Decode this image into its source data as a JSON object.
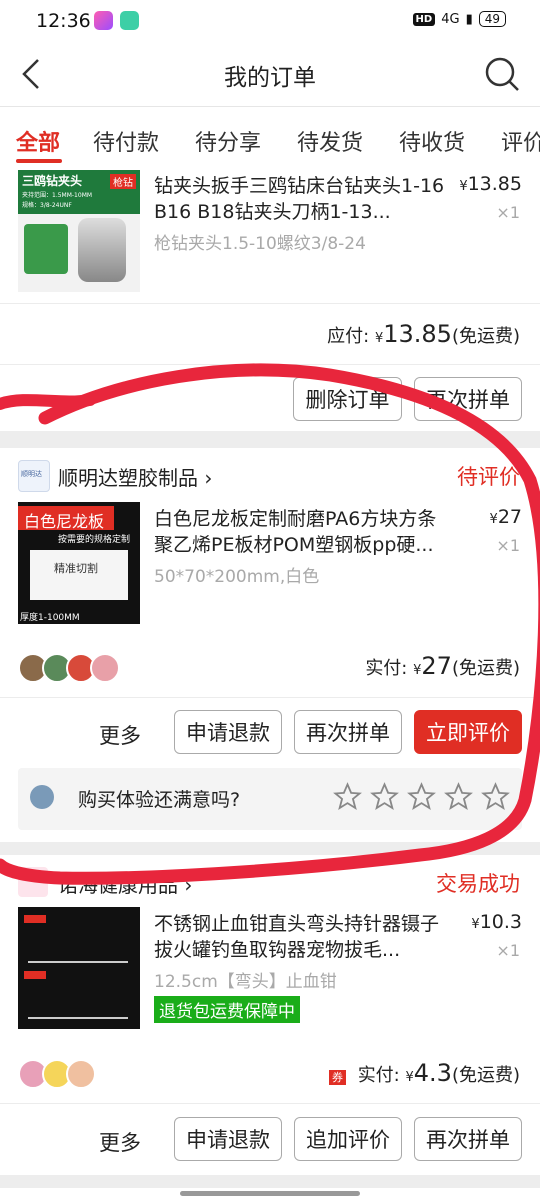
{
  "status_bar": {
    "time": "12:36",
    "network": "4G",
    "battery": "49"
  },
  "nav": {
    "title": "我的订单"
  },
  "tabs": [
    "全部",
    "待付款",
    "待分享",
    "待发货",
    "待收货",
    "评价"
  ],
  "order1": {
    "image_label_title": "三鸥钻夹头",
    "image_label_tag": "枪钻",
    "image_spec_1": "夹持范围：1.5MM-10MM",
    "image_spec_2": "规格：3/8-24UNF",
    "name": "钻夹头扳手三鸥钻床台钻夹头1-16 B16 B18钻夹头刀柄1-13...",
    "spec": "枪钻夹头1.5-10螺纹3/8-24",
    "currency": "¥",
    "price": "13.85",
    "qty": "×1",
    "pay_label": "应付:",
    "pay_currency": "¥",
    "pay_amount": "13.85",
    "shipping": "(免运费)",
    "btn_delete": "删除订单",
    "btn_rebuy": "再次拼单"
  },
  "order2": {
    "shop": "顺明达塑胶制品",
    "shop_logo_text": "顺明达",
    "status": "待评价",
    "image_label_title": "白色尼龙板",
    "image_label_sub": "按需要的规格定制",
    "image_label_cut": "精准切割",
    "image_label_thick": "厚度1-100MM",
    "name": "白色尼龙板定制耐磨PA6方块方条聚乙烯PE板材POM塑钢板pp硬...",
    "spec": "50*70*200mm,白色",
    "currency": "¥",
    "price": "27",
    "qty": "×1",
    "pay_label": "实付:",
    "pay_currency": "¥",
    "pay_amount": "27",
    "shipping": "(免运费)",
    "more": "更多",
    "btn_refund": "申请退款",
    "btn_rebuy": "再次拼单",
    "btn_review": "立即评价",
    "rate_question": "购买体验还满意吗?"
  },
  "order3": {
    "shop": "诺海健康用品",
    "status": "交易成功",
    "name": "不锈钢止血钳直头弯头持针器镊子拔火罐钓鱼取钩器宠物拔毛...",
    "spec": "12.5cm【弯头】止血钳",
    "guarantee": "退货包运费保障中",
    "currency": "¥",
    "price": "10.3",
    "qty": "×1",
    "coupon": "券",
    "pay_label": "实付:",
    "pay_currency": "¥",
    "pay_amount": "4.3",
    "shipping": "(免运费)",
    "more": "更多",
    "btn_refund": "申请退款",
    "btn_addreview": "追加评价",
    "btn_rebuy": "再次拼单"
  },
  "colors": {
    "accent": "#e02e24",
    "guarantee_bg": "#1aad19",
    "ink": "#e8263c"
  }
}
